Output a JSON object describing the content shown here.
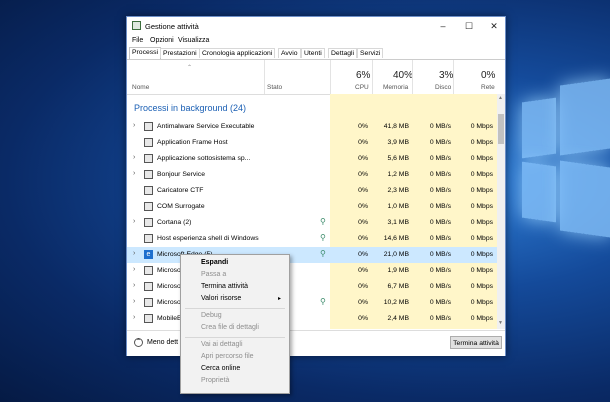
{
  "window": {
    "title": "Gestione attività"
  },
  "menubar": [
    "File",
    "Opzioni",
    "Visualizza"
  ],
  "tabs": [
    "Processi",
    "Prestazioni",
    "Cronologia applicazioni",
    "Avvio",
    "Utenti",
    "Dettagli",
    "Servizi"
  ],
  "columns": {
    "name": "Nome",
    "status": "Stato",
    "cpu": {
      "pct": "6%",
      "label": "CPU"
    },
    "memory": {
      "pct": "40%",
      "label": "Memoria"
    },
    "disk": {
      "pct": "3%",
      "label": "Disco"
    },
    "network": {
      "pct": "0%",
      "label": "Rete"
    }
  },
  "section": "Processi in background (24)",
  "processes": [
    {
      "name": "Antimalware Service Executable",
      "cpu": "0%",
      "mem": "41,8 MB",
      "disk": "0 MB/s",
      "net": "0 Mbps",
      "expand": true,
      "icon": "app-window-icon"
    },
    {
      "name": "Application Frame Host",
      "cpu": "0%",
      "mem": "3,9 MB",
      "disk": "0 MB/s",
      "net": "0 Mbps",
      "expand": false,
      "icon": "app-window-icon"
    },
    {
      "name": "Applicazione sottosistema sp...",
      "cpu": "0%",
      "mem": "5,6 MB",
      "disk": "0 MB/s",
      "net": "0 Mbps",
      "expand": true,
      "icon": "printer-icon"
    },
    {
      "name": "Bonjour Service",
      "cpu": "0%",
      "mem": "1,2 MB",
      "disk": "0 MB/s",
      "net": "0 Mbps",
      "expand": true,
      "icon": "app-window-icon"
    },
    {
      "name": "Caricatore CTF",
      "cpu": "0%",
      "mem": "2,3 MB",
      "disk": "0 MB/s",
      "net": "0 Mbps",
      "expand": false,
      "icon": "keyboard-icon"
    },
    {
      "name": "COM Surrogate",
      "cpu": "0%",
      "mem": "1,0 MB",
      "disk": "0 MB/s",
      "net": "0 Mbps",
      "expand": false,
      "icon": "app-window-icon"
    },
    {
      "name": "Cortana (2)",
      "cpu": "0%",
      "mem": "3,1 MB",
      "disk": "0 MB/s",
      "net": "0 Mbps",
      "expand": true,
      "icon": "app-window-icon",
      "leaf": true
    },
    {
      "name": "Host esperienza shell di Windows",
      "cpu": "0%",
      "mem": "14,6 MB",
      "disk": "0 MB/s",
      "net": "0 Mbps",
      "expand": false,
      "icon": "app-window-icon",
      "leaf": true
    },
    {
      "name": "Microsoft Edge (5)",
      "cpu": "0%",
      "mem": "21,0 MB",
      "disk": "0 MB/s",
      "net": "0 Mbps",
      "expand": true,
      "icon": "edge-icon",
      "leaf": true,
      "selected": true
    },
    {
      "name": "Microso",
      "cpu": "0%",
      "mem": "1,9 MB",
      "disk": "0 MB/s",
      "net": "0 Mbps",
      "expand": true,
      "icon": "app-window-icon"
    },
    {
      "name": "Microso",
      "cpu": "0%",
      "mem": "6,7 MB",
      "disk": "0 MB/s",
      "net": "0 Mbps",
      "expand": true,
      "icon": "user-icon"
    },
    {
      "name": "Microso",
      "cpu": "0%",
      "mem": "10,2 MB",
      "disk": "0 MB/s",
      "net": "0 Mbps",
      "expand": true,
      "icon": "app-window-icon",
      "leaf": true
    },
    {
      "name": "MobileB",
      "cpu": "0%",
      "mem": "2,4 MB",
      "disk": "0 MB/s",
      "net": "0 Mbps",
      "expand": true,
      "icon": "app-window-icon"
    }
  ],
  "footer": {
    "less_details": "Meno dett",
    "end_task": "Termina attività"
  },
  "context_menu": {
    "expand": "Espandi",
    "switch_to": "Passa a",
    "end_task": "Termina attività",
    "resource_values": "Valori risorse",
    "debug": "Debug",
    "create_dump": "Crea file di dettagli",
    "go_to_details": "Vai ai dettagli",
    "open_location": "Apri percorso file",
    "search_online": "Cerca online",
    "properties": "Proprietà"
  }
}
